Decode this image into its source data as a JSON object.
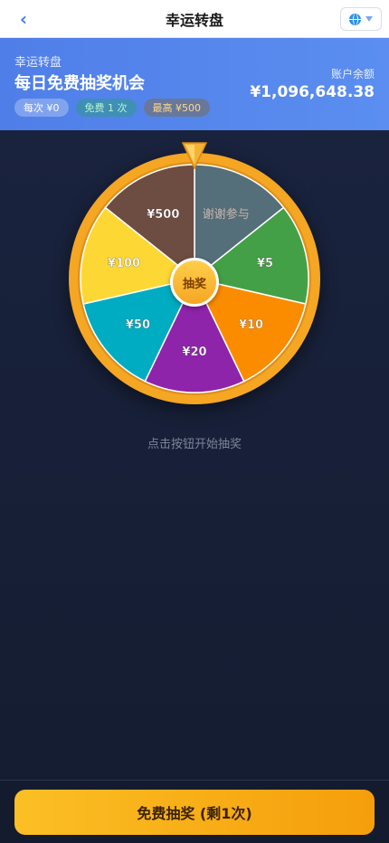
{
  "nav": {
    "back_icon": "chevron-left-icon",
    "title": "幸运转盘",
    "lang_icon": "globe-icon"
  },
  "header": {
    "subtitle": "幸运转盘",
    "headline": "每日免费抽奖机会",
    "pills": {
      "cost": "每次 ¥0",
      "free": "免费 1 次",
      "max": "最高 ¥500"
    },
    "balance_label": "账户余额",
    "balance_value": "¥1,096,648.38"
  },
  "wheel": {
    "segments": [
      {
        "label": "谢谢参与",
        "color": "#546e7a"
      },
      {
        "label": "¥5",
        "color": "#43a047"
      },
      {
        "label": "¥10",
        "color": "#fb8c00"
      },
      {
        "label": "¥20",
        "color": "#8e24aa"
      },
      {
        "label": "¥50",
        "color": "#00acc1"
      },
      {
        "label": "¥100",
        "color": "#fdd835"
      },
      {
        "label": "¥500",
        "color": "#6d4c41"
      }
    ],
    "rim_color": "#f5a623",
    "center_label": "抽奖"
  },
  "hint": "点击按钮开始抽奖",
  "draw_button": "免费抽奖 (剩1次)"
}
